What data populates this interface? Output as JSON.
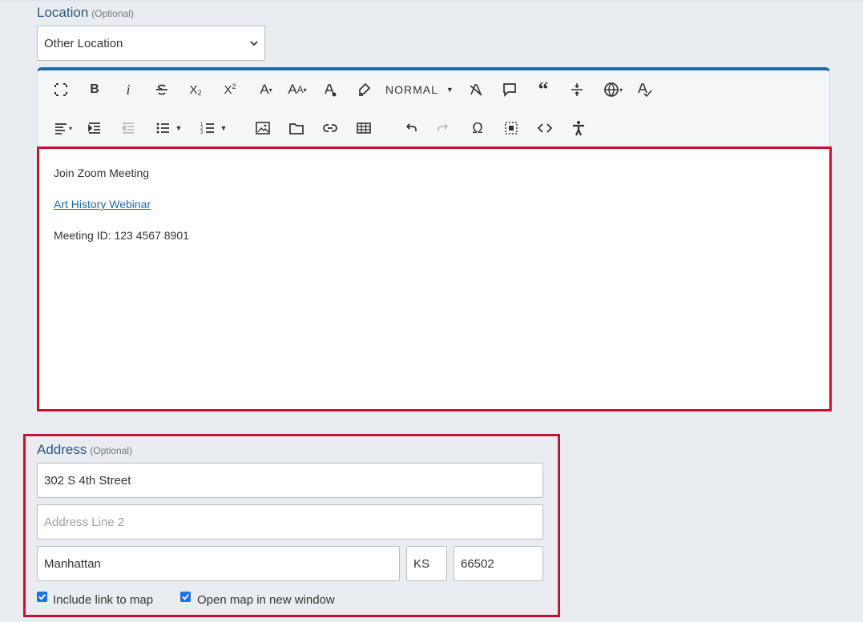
{
  "location": {
    "label": "Location",
    "optional": "(Optional)",
    "selected": "Other Location"
  },
  "toolbar": {
    "paragraph_format": "NORMAL",
    "icons_row1": [
      "fullscreen-icon",
      "bold-icon",
      "italic-icon",
      "strikethrough-icon",
      "subscript-icon",
      "superscript-icon",
      "font-family-icon",
      "font-size-icon",
      "text-color-icon",
      "highlight-icon",
      "paragraph-format-dropdown",
      "clear-formatting-icon",
      "comment-icon",
      "quote-icon",
      "horizontal-line-icon",
      "language-icon",
      "spellcheck-icon"
    ],
    "icons_row2": [
      "align-icon",
      "indent-icon",
      "outdent-icon",
      "bulleted-list-icon",
      "numbered-list-icon",
      "image-icon",
      "file-icon",
      "link-icon",
      "table-icon",
      "undo-icon",
      "redo-icon",
      "special-characters-icon",
      "select-all-icon",
      "code-view-icon",
      "accessibility-icon"
    ]
  },
  "content": {
    "line1": "Join Zoom Meeting",
    "link": "Art History Webinar",
    "line3": "Meeting ID: 123 4567 8901"
  },
  "address": {
    "label": "Address",
    "optional": "(Optional)",
    "line1": "302 S 4th Street",
    "line2_placeholder": "Address Line 2",
    "city": "Manhattan",
    "state": "KS",
    "zip": "66502",
    "include_map_label": "Include link to map",
    "new_window_label": "Open map in new window"
  },
  "colors": {
    "accent": "#1f6aa8",
    "highlight_border": "#c4122f",
    "label": "#2b5580"
  }
}
